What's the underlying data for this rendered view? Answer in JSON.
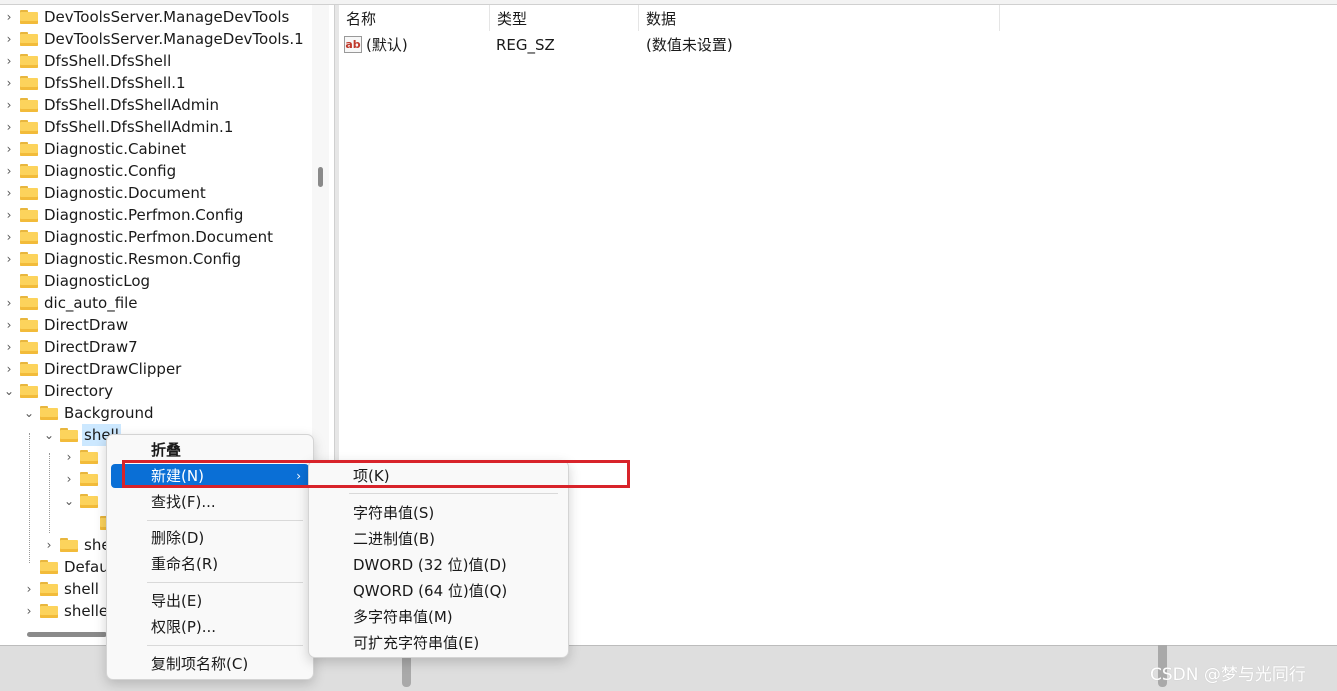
{
  "tree": {
    "items": [
      {
        "label": "DevToolsServer.ManageDevTools",
        "expanded": false
      },
      {
        "label": "DevToolsServer.ManageDevTools.1",
        "expanded": false
      },
      {
        "label": "DfsShell.DfsShell",
        "expanded": false
      },
      {
        "label": "DfsShell.DfsShell.1",
        "expanded": false
      },
      {
        "label": "DfsShell.DfsShellAdmin",
        "expanded": false
      },
      {
        "label": "DfsShell.DfsShellAdmin.1",
        "expanded": false
      },
      {
        "label": "Diagnostic.Cabinet",
        "expanded": false
      },
      {
        "label": "Diagnostic.Config",
        "expanded": false
      },
      {
        "label": "Diagnostic.Document",
        "expanded": false
      },
      {
        "label": "Diagnostic.Perfmon.Config",
        "expanded": false
      },
      {
        "label": "Diagnostic.Perfmon.Document",
        "expanded": false
      },
      {
        "label": "Diagnostic.Resmon.Config",
        "expanded": false
      },
      {
        "label": "DiagnosticLog",
        "expanded": false
      },
      {
        "label": "dic_auto_file",
        "expanded": false
      },
      {
        "label": "DirectDraw",
        "expanded": false
      },
      {
        "label": "DirectDraw7",
        "expanded": false
      },
      {
        "label": "DirectDrawClipper",
        "expanded": false
      },
      {
        "label": "Directory",
        "expanded": true
      },
      {
        "label": "Background",
        "expanded": true
      },
      {
        "label": "shell",
        "expanded": true,
        "selected": true
      },
      {
        "label": "she",
        "expanded": false
      },
      {
        "label": "Defau",
        "expanded": false
      },
      {
        "label": "shell",
        "expanded": false
      },
      {
        "label": "shelle",
        "expanded": false
      }
    ]
  },
  "list": {
    "columns": [
      "名称",
      "类型",
      "数据"
    ],
    "rows": [
      {
        "name": "(默认)",
        "type": "REG_SZ",
        "data": "(数值未设置)",
        "icon": "ab-string-icon"
      }
    ]
  },
  "context_menu": {
    "items": {
      "collapse": "折叠",
      "new": "新建(N)",
      "find": "查找(F)...",
      "delete": "删除(D)",
      "rename": "重命名(R)",
      "export": "导出(E)",
      "permissions": "权限(P)...",
      "copy_key_name": "复制项名称(C)"
    }
  },
  "submenu": {
    "items": {
      "key": "项(K)",
      "string": "字符串值(S)",
      "binary": "二进制值(B)",
      "dword": "DWORD (32 位)值(D)",
      "qword": "QWORD (64 位)值(Q)",
      "multi_string": "多字符串值(M)",
      "expandable_string": "可扩充字符串值(E)"
    }
  },
  "watermark": "CSDN @梦与光同行",
  "colors": {
    "highlight": "#0a6fd6",
    "selection": "#cce8ff",
    "annotation": "#d8232a",
    "folder": "#fcd35c"
  }
}
